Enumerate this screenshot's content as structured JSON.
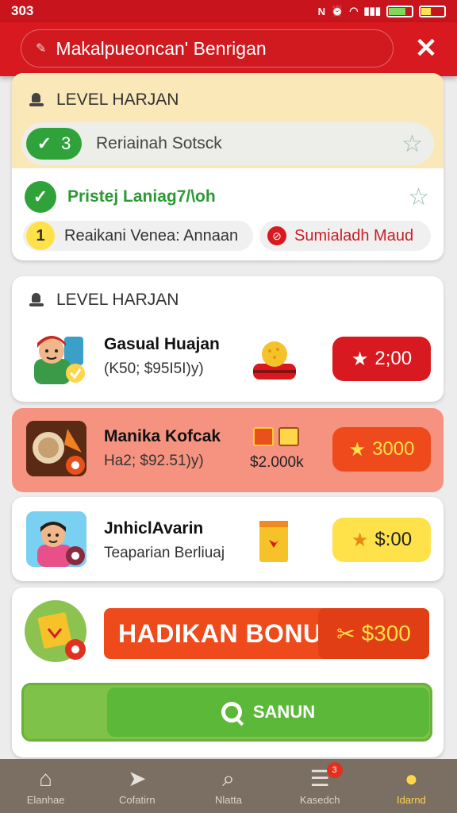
{
  "status_bar": {
    "time": "303"
  },
  "header": {
    "title": "Makalpueoncan' Benrigan",
    "close_label": "✕"
  },
  "daily_card": {
    "heading": "LEVEL HARJAN",
    "task1": {
      "count": "3",
      "text": "Reriainah Sotsck"
    },
    "task2": {
      "text": "Pristej Laniag7/\\oh"
    },
    "pill_a": {
      "num": "1",
      "text": "Reaikani Venea: Annaan"
    },
    "pill_b": {
      "text": "Sumialadh Maud"
    }
  },
  "level_card": {
    "heading": "LEVEL HARJAN"
  },
  "offers": [
    {
      "title": "Gasual Huajan",
      "subtitle": "(K50; $95I5I)y)",
      "reward": "2;00",
      "reward_color": "#d8191f"
    },
    {
      "title": "Manika Kofcak",
      "subtitle": "Ha2; $92.51)y)",
      "price": "$2.000k",
      "reward": "3000",
      "reward_color": "#ef4a1c"
    },
    {
      "title": "JnhiclAvarin",
      "subtitle": "Teaparian Berliuaj",
      "reward": "$:00",
      "reward_color": "#ffe14a"
    }
  ],
  "bonus": {
    "label": "HADIKAN BONU",
    "amount": "$300",
    "claim_label": "SANUN"
  },
  "nav": [
    {
      "label": "Elanhae",
      "icon": "home-icon"
    },
    {
      "label": "Cofatirn",
      "icon": "send-icon"
    },
    {
      "label": "Nlatta",
      "icon": "search-icon"
    },
    {
      "label": "Kasedch",
      "icon": "list-icon",
      "badge": "3"
    },
    {
      "label": "Idarnd",
      "icon": "profile-icon"
    }
  ]
}
